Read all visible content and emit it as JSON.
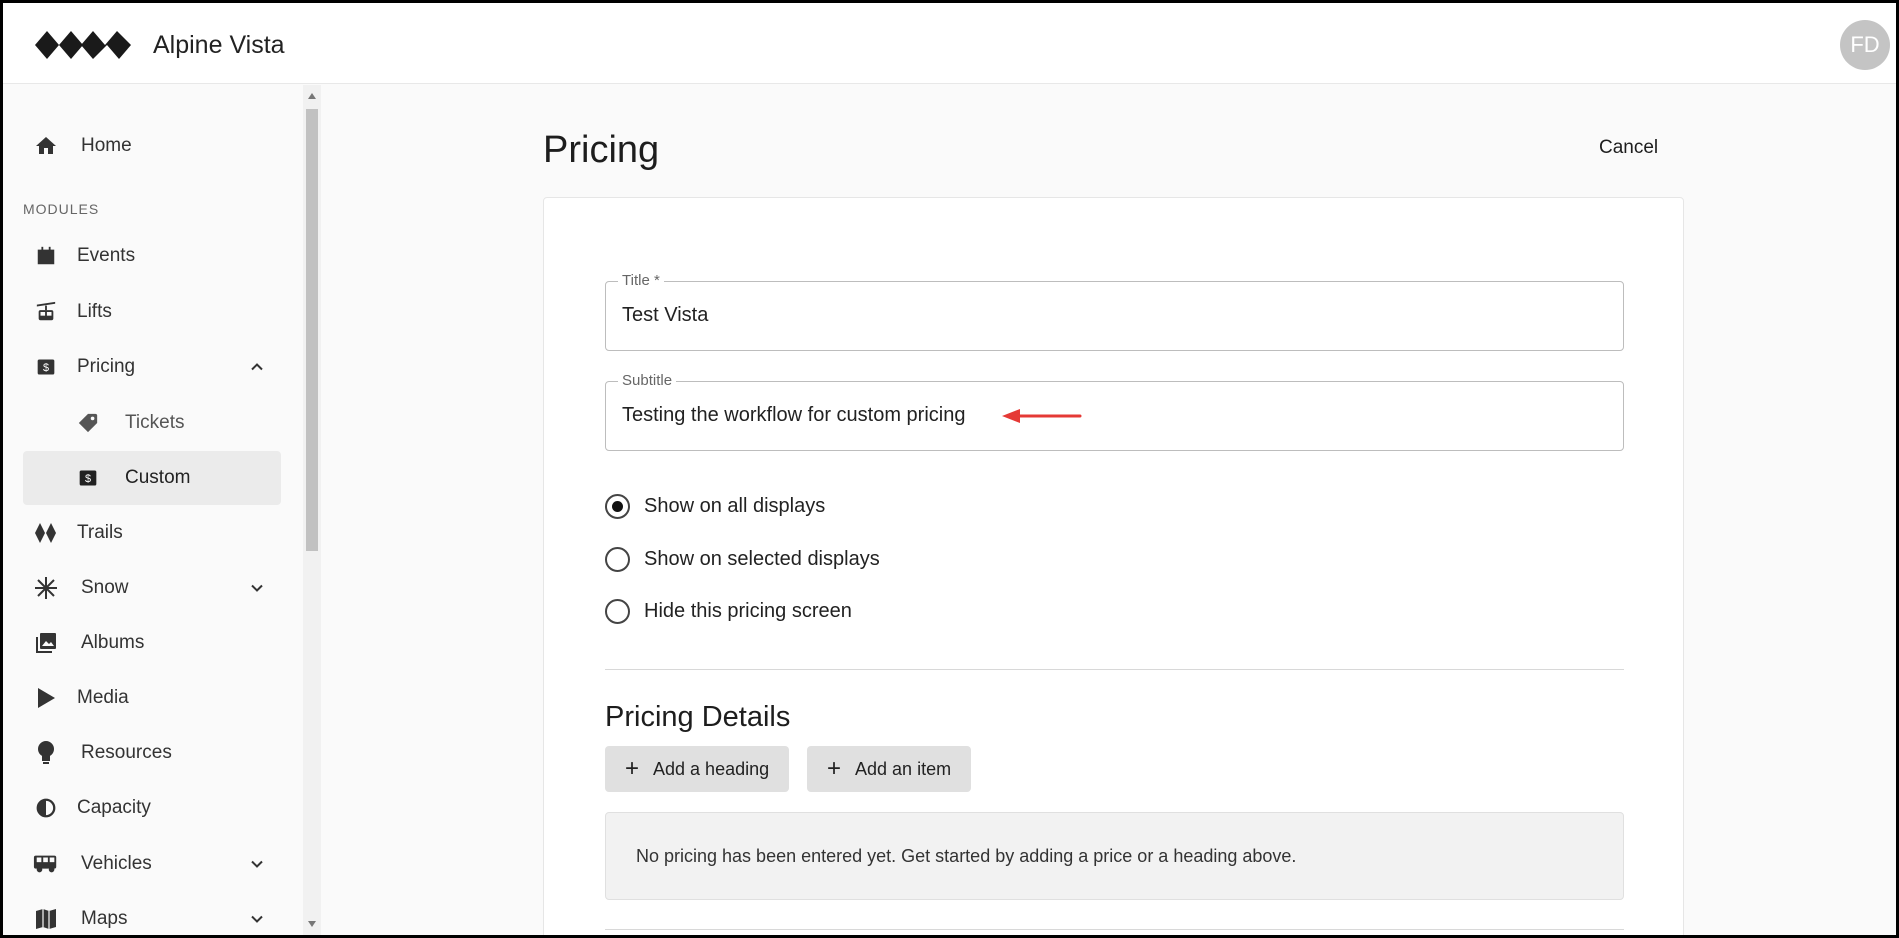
{
  "app": {
    "title": "Alpine Vista",
    "avatar_initials": "FD"
  },
  "sidebar": {
    "section_label": "MODULES",
    "items": [
      {
        "label": "Home",
        "icon": "home-icon"
      },
      {
        "label": "Events",
        "icon": "calendar-icon"
      },
      {
        "label": "Lifts",
        "icon": "gondola-icon"
      },
      {
        "label": "Pricing",
        "icon": "dollar-icon",
        "expanded": true
      },
      {
        "label": "Tickets",
        "icon": "tag-icon"
      },
      {
        "label": "Custom",
        "icon": "dollar-icon",
        "active": true
      },
      {
        "label": "Trails",
        "icon": "diamond-icon"
      },
      {
        "label": "Snow",
        "icon": "snowflake-icon"
      },
      {
        "label": "Albums",
        "icon": "photo-library-icon"
      },
      {
        "label": "Media",
        "icon": "play-icon"
      },
      {
        "label": "Resources",
        "icon": "lightbulb-icon"
      },
      {
        "label": "Capacity",
        "icon": "capacity-icon"
      },
      {
        "label": "Vehicles",
        "icon": "bus-icon"
      },
      {
        "label": "Maps",
        "icon": "map-icon"
      }
    ]
  },
  "main": {
    "page_title": "Pricing",
    "cancel_label": "Cancel",
    "title_field": {
      "label": "Title *",
      "value": "Test Vista"
    },
    "subtitle_field": {
      "label": "Subtitle",
      "value": "Testing the workflow for custom pricing"
    },
    "display_options": [
      {
        "label": "Show on all displays",
        "checked": true
      },
      {
        "label": "Show on selected displays",
        "checked": false
      },
      {
        "label": "Hide this pricing screen",
        "checked": false
      }
    ],
    "details_title": "Pricing Details",
    "add_heading_label": "Add a heading",
    "add_item_label": "Add an item",
    "empty_message": "No pricing has been entered yet. Get started by adding a price or a heading above."
  },
  "colors": {
    "annotation_arrow": "#e53935",
    "active_nav_bg": "#ebebeb"
  }
}
